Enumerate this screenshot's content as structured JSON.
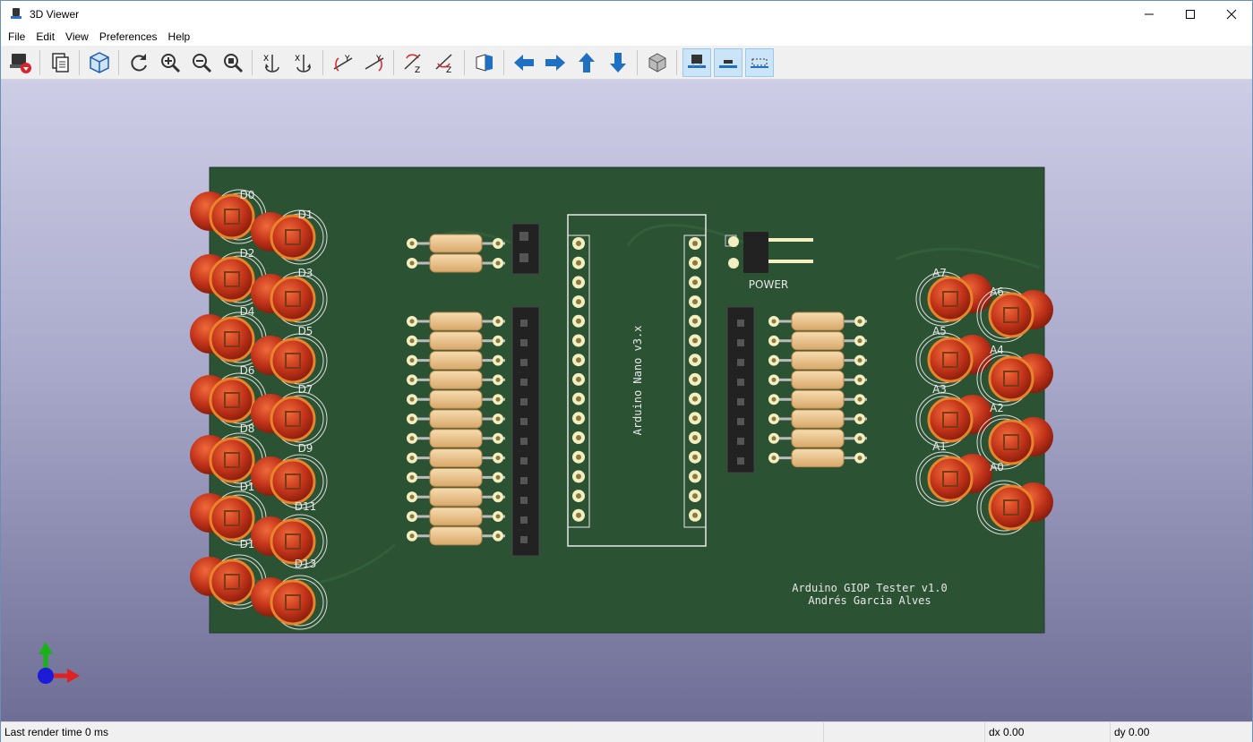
{
  "window": {
    "title": "3D Viewer"
  },
  "menu": {
    "file": "File",
    "edit": "Edit",
    "view": "View",
    "preferences": "Preferences",
    "help": "Help"
  },
  "toolbar_icons": [
    "render-raytracing-icon",
    "copy-image-icon",
    "3d-options-icon",
    "reload-icon",
    "zoom-in-icon",
    "zoom-out-icon",
    "zoom-fit-icon",
    "rotate-x-ccw-icon",
    "rotate-x-cw-icon",
    "rotate-y-ccw-icon",
    "rotate-y-cw-icon",
    "rotate-z-ccw-icon",
    "rotate-z-cw-icon",
    "flip-board-icon",
    "pan-left-icon",
    "pan-right-icon",
    "pan-up-icon",
    "pan-down-icon",
    "ortho-view-icon",
    "show-tht-icon",
    "show-smd-icon",
    "show-virtual-icon"
  ],
  "board": {
    "left_labels": [
      "D0",
      "D1",
      "D2",
      "D3",
      "D4",
      "D5",
      "D6",
      "D7",
      "D8",
      "D9",
      "D10",
      "D11",
      "D12",
      "D13"
    ],
    "left_labels_shown": [
      "D0",
      "D1",
      "D2",
      "D3",
      "D4",
      "D5",
      "D6",
      "D7",
      "D8",
      "D9",
      "D1",
      "D11",
      "D1",
      "D13"
    ],
    "right_labels": [
      "A7",
      "A6",
      "A5",
      "A4",
      "A3",
      "A2",
      "A1",
      "A0"
    ],
    "module_label": "Arduino Nano v3.x",
    "power_label": "POWER",
    "silk_line1": "Arduino GIOP Tester v1.0",
    "silk_line2": "Andrés Garcia Alves"
  },
  "colors": {
    "pcb": "#2c5234",
    "led": "#c2331a",
    "ring": "#e8842a",
    "pad": "#f3efc0"
  },
  "status": {
    "render_time": "Last render time 0 ms",
    "dx": "dx 0.00",
    "dy": "dy 0.00"
  }
}
